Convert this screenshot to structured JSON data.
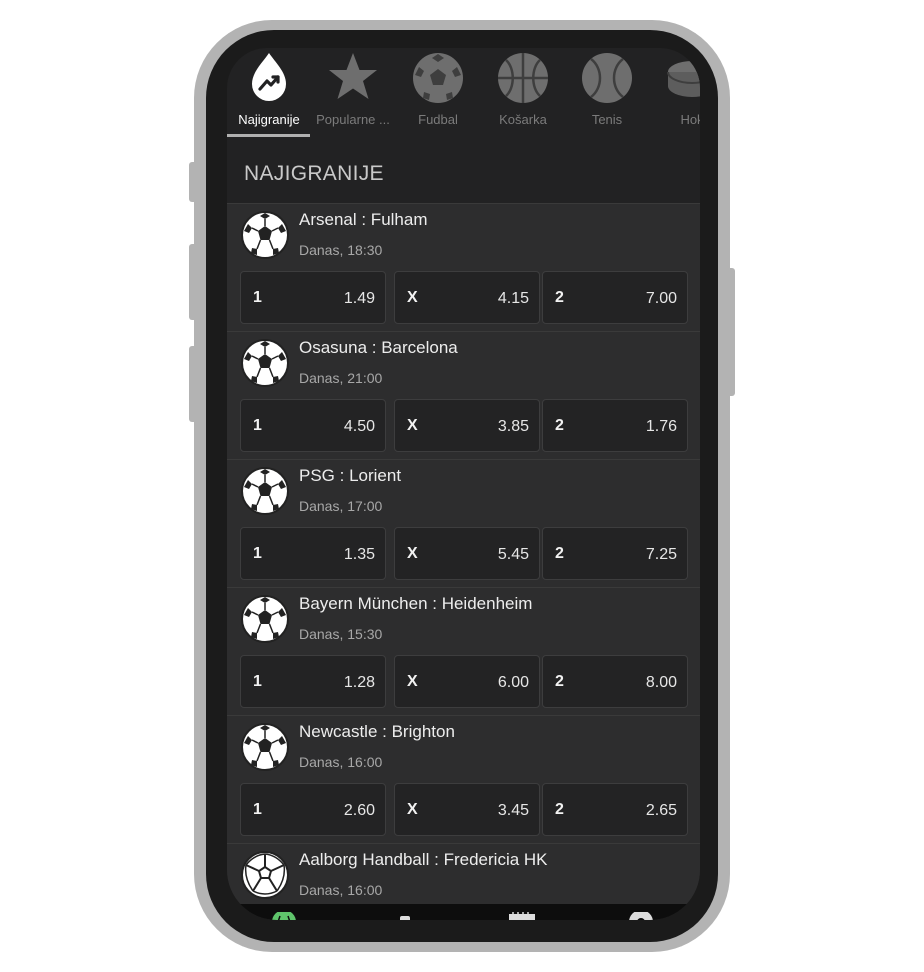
{
  "tabs": [
    {
      "label": "Najigranije",
      "icon": "trending-drop-icon",
      "active": true
    },
    {
      "label": "Popularne ...",
      "icon": "star-icon",
      "active": false
    },
    {
      "label": "Fudbal",
      "icon": "soccer-ball-icon",
      "active": false
    },
    {
      "label": "Košarka",
      "icon": "basketball-icon",
      "active": false
    },
    {
      "label": "Tenis",
      "icon": "tennis-ball-icon",
      "active": false
    },
    {
      "label": "Hok",
      "icon": "hockey-puck-icon",
      "active": false
    }
  ],
  "section_title": "NAJIGRANIJE",
  "matches": [
    {
      "teams": "Arsenal : Fulham",
      "time": "Danas, 18:30",
      "icon": "soccer-ball-icon",
      "odds": [
        {
          "key": "1",
          "value": "1.49"
        },
        {
          "key": "X",
          "value": "4.15"
        },
        {
          "key": "2",
          "value": "7.00"
        }
      ]
    },
    {
      "teams": "Osasuna : Barcelona",
      "time": "Danas, 21:00",
      "icon": "soccer-ball-icon",
      "odds": [
        {
          "key": "1",
          "value": "4.50"
        },
        {
          "key": "X",
          "value": "3.85"
        },
        {
          "key": "2",
          "value": "1.76"
        }
      ]
    },
    {
      "teams": "PSG : Lorient",
      "time": "Danas, 17:00",
      "icon": "soccer-ball-icon",
      "odds": [
        {
          "key": "1",
          "value": "1.35"
        },
        {
          "key": "X",
          "value": "5.45"
        },
        {
          "key": "2",
          "value": "7.25"
        }
      ]
    },
    {
      "teams": "Bayern München : Heidenheim",
      "time": "Danas, 15:30",
      "icon": "soccer-ball-icon",
      "odds": [
        {
          "key": "1",
          "value": "1.28"
        },
        {
          "key": "X",
          "value": "6.00"
        },
        {
          "key": "2",
          "value": "8.00"
        }
      ]
    },
    {
      "teams": "Newcastle : Brighton",
      "time": "Danas, 16:00",
      "icon": "soccer-ball-icon",
      "odds": [
        {
          "key": "1",
          "value": "2.60"
        },
        {
          "key": "X",
          "value": "3.45"
        },
        {
          "key": "2",
          "value": "2.65"
        }
      ]
    },
    {
      "teams": "Aalborg Handball : Fredericia HK",
      "time": "Danas, 16:00",
      "icon": "handball-icon",
      "odds": []
    }
  ],
  "bottom_nav": [
    {
      "icon": "sports-nav-icon",
      "color": "#5fc46b"
    },
    {
      "icon": "live-nav-icon",
      "color": "#dddddd"
    },
    {
      "icon": "ticket-nav-icon",
      "color": "#dddddd"
    },
    {
      "icon": "settings-nav-icon",
      "color": "#dddddd"
    }
  ],
  "colors": {
    "accent_green": "#5fc46b",
    "background": "#222223",
    "card": "#2d2d2e"
  }
}
